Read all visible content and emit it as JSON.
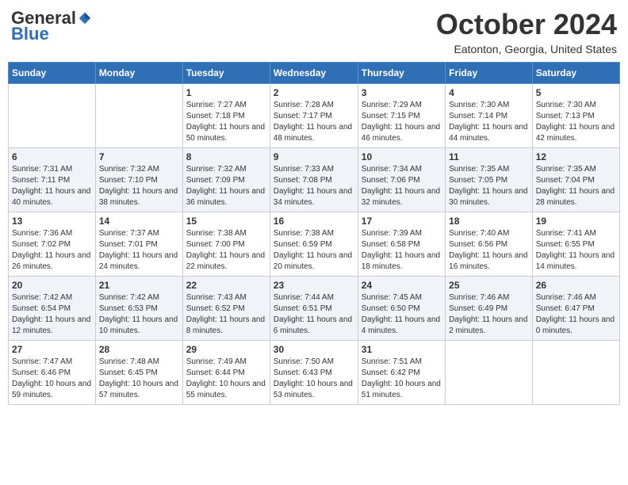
{
  "header": {
    "logo": {
      "general": "General",
      "blue": "Blue"
    },
    "title": "October 2024",
    "location": "Eatonton, Georgia, United States"
  },
  "weekdays": [
    "Sunday",
    "Monday",
    "Tuesday",
    "Wednesday",
    "Thursday",
    "Friday",
    "Saturday"
  ],
  "weeks": [
    [
      {
        "day": "",
        "sunrise": "",
        "sunset": "",
        "daylight": ""
      },
      {
        "day": "",
        "sunrise": "",
        "sunset": "",
        "daylight": ""
      },
      {
        "day": "1",
        "sunrise": "Sunrise: 7:27 AM",
        "sunset": "Sunset: 7:18 PM",
        "daylight": "Daylight: 11 hours and 50 minutes."
      },
      {
        "day": "2",
        "sunrise": "Sunrise: 7:28 AM",
        "sunset": "Sunset: 7:17 PM",
        "daylight": "Daylight: 11 hours and 48 minutes."
      },
      {
        "day": "3",
        "sunrise": "Sunrise: 7:29 AM",
        "sunset": "Sunset: 7:15 PM",
        "daylight": "Daylight: 11 hours and 46 minutes."
      },
      {
        "day": "4",
        "sunrise": "Sunrise: 7:30 AM",
        "sunset": "Sunset: 7:14 PM",
        "daylight": "Daylight: 11 hours and 44 minutes."
      },
      {
        "day": "5",
        "sunrise": "Sunrise: 7:30 AM",
        "sunset": "Sunset: 7:13 PM",
        "daylight": "Daylight: 11 hours and 42 minutes."
      }
    ],
    [
      {
        "day": "6",
        "sunrise": "Sunrise: 7:31 AM",
        "sunset": "Sunset: 7:11 PM",
        "daylight": "Daylight: 11 hours and 40 minutes."
      },
      {
        "day": "7",
        "sunrise": "Sunrise: 7:32 AM",
        "sunset": "Sunset: 7:10 PM",
        "daylight": "Daylight: 11 hours and 38 minutes."
      },
      {
        "day": "8",
        "sunrise": "Sunrise: 7:32 AM",
        "sunset": "Sunset: 7:09 PM",
        "daylight": "Daylight: 11 hours and 36 minutes."
      },
      {
        "day": "9",
        "sunrise": "Sunrise: 7:33 AM",
        "sunset": "Sunset: 7:08 PM",
        "daylight": "Daylight: 11 hours and 34 minutes."
      },
      {
        "day": "10",
        "sunrise": "Sunrise: 7:34 AM",
        "sunset": "Sunset: 7:06 PM",
        "daylight": "Daylight: 11 hours and 32 minutes."
      },
      {
        "day": "11",
        "sunrise": "Sunrise: 7:35 AM",
        "sunset": "Sunset: 7:05 PM",
        "daylight": "Daylight: 11 hours and 30 minutes."
      },
      {
        "day": "12",
        "sunrise": "Sunrise: 7:35 AM",
        "sunset": "Sunset: 7:04 PM",
        "daylight": "Daylight: 11 hours and 28 minutes."
      }
    ],
    [
      {
        "day": "13",
        "sunrise": "Sunrise: 7:36 AM",
        "sunset": "Sunset: 7:02 PM",
        "daylight": "Daylight: 11 hours and 26 minutes."
      },
      {
        "day": "14",
        "sunrise": "Sunrise: 7:37 AM",
        "sunset": "Sunset: 7:01 PM",
        "daylight": "Daylight: 11 hours and 24 minutes."
      },
      {
        "day": "15",
        "sunrise": "Sunrise: 7:38 AM",
        "sunset": "Sunset: 7:00 PM",
        "daylight": "Daylight: 11 hours and 22 minutes."
      },
      {
        "day": "16",
        "sunrise": "Sunrise: 7:38 AM",
        "sunset": "Sunset: 6:59 PM",
        "daylight": "Daylight: 11 hours and 20 minutes."
      },
      {
        "day": "17",
        "sunrise": "Sunrise: 7:39 AM",
        "sunset": "Sunset: 6:58 PM",
        "daylight": "Daylight: 11 hours and 18 minutes."
      },
      {
        "day": "18",
        "sunrise": "Sunrise: 7:40 AM",
        "sunset": "Sunset: 6:56 PM",
        "daylight": "Daylight: 11 hours and 16 minutes."
      },
      {
        "day": "19",
        "sunrise": "Sunrise: 7:41 AM",
        "sunset": "Sunset: 6:55 PM",
        "daylight": "Daylight: 11 hours and 14 minutes."
      }
    ],
    [
      {
        "day": "20",
        "sunrise": "Sunrise: 7:42 AM",
        "sunset": "Sunset: 6:54 PM",
        "daylight": "Daylight: 11 hours and 12 minutes."
      },
      {
        "day": "21",
        "sunrise": "Sunrise: 7:42 AM",
        "sunset": "Sunset: 6:53 PM",
        "daylight": "Daylight: 11 hours and 10 minutes."
      },
      {
        "day": "22",
        "sunrise": "Sunrise: 7:43 AM",
        "sunset": "Sunset: 6:52 PM",
        "daylight": "Daylight: 11 hours and 8 minutes."
      },
      {
        "day": "23",
        "sunrise": "Sunrise: 7:44 AM",
        "sunset": "Sunset: 6:51 PM",
        "daylight": "Daylight: 11 hours and 6 minutes."
      },
      {
        "day": "24",
        "sunrise": "Sunrise: 7:45 AM",
        "sunset": "Sunset: 6:50 PM",
        "daylight": "Daylight: 11 hours and 4 minutes."
      },
      {
        "day": "25",
        "sunrise": "Sunrise: 7:46 AM",
        "sunset": "Sunset: 6:49 PM",
        "daylight": "Daylight: 11 hours and 2 minutes."
      },
      {
        "day": "26",
        "sunrise": "Sunrise: 7:46 AM",
        "sunset": "Sunset: 6:47 PM",
        "daylight": "Daylight: 11 hours and 0 minutes."
      }
    ],
    [
      {
        "day": "27",
        "sunrise": "Sunrise: 7:47 AM",
        "sunset": "Sunset: 6:46 PM",
        "daylight": "Daylight: 10 hours and 59 minutes."
      },
      {
        "day": "28",
        "sunrise": "Sunrise: 7:48 AM",
        "sunset": "Sunset: 6:45 PM",
        "daylight": "Daylight: 10 hours and 57 minutes."
      },
      {
        "day": "29",
        "sunrise": "Sunrise: 7:49 AM",
        "sunset": "Sunset: 6:44 PM",
        "daylight": "Daylight: 10 hours and 55 minutes."
      },
      {
        "day": "30",
        "sunrise": "Sunrise: 7:50 AM",
        "sunset": "Sunset: 6:43 PM",
        "daylight": "Daylight: 10 hours and 53 minutes."
      },
      {
        "day": "31",
        "sunrise": "Sunrise: 7:51 AM",
        "sunset": "Sunset: 6:42 PM",
        "daylight": "Daylight: 10 hours and 51 minutes."
      },
      {
        "day": "",
        "sunrise": "",
        "sunset": "",
        "daylight": ""
      },
      {
        "day": "",
        "sunrise": "",
        "sunset": "",
        "daylight": ""
      }
    ]
  ]
}
